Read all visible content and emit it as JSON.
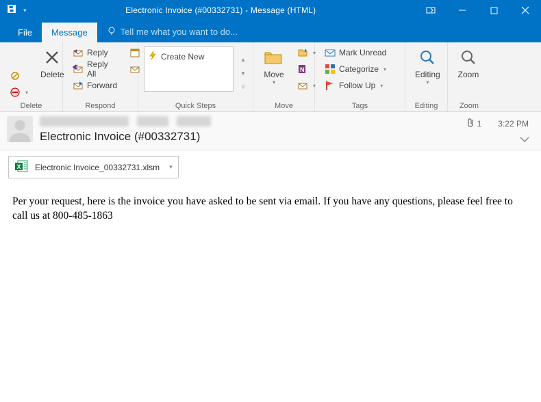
{
  "titlebar": {
    "title": "Electronic Invoice (#00332731) - Message (HTML)"
  },
  "tabs": {
    "file": "File",
    "message": "Message",
    "tell_me": "Tell me what you want to do..."
  },
  "ribbon": {
    "delete_group": {
      "label": "Delete",
      "delete": "Delete"
    },
    "respond_group": {
      "label": "Respond",
      "reply": "Reply",
      "reply_all": "Reply All",
      "forward": "Forward"
    },
    "quicksteps_group": {
      "label": "Quick Steps",
      "create_new": "Create New"
    },
    "move_group": {
      "label": "Move",
      "move": "Move"
    },
    "tags_group": {
      "label": "Tags",
      "mark_unread": "Mark Unread",
      "categorize": "Categorize",
      "follow_up": "Follow Up"
    },
    "editing_group": {
      "label": "Editing",
      "editing": "Editing"
    },
    "zoom_group": {
      "label": "Zoom",
      "zoom": "Zoom"
    }
  },
  "message": {
    "subject": "Electronic Invoice (#00332731)",
    "attachment_count": "1",
    "time": "3:22 PM",
    "attachment_name": "Electronic Invoice_00332731.xlsm",
    "body": "Per your request, here is the invoice you have asked to be sent via email. If you have any questions, please feel free to call us at 800-485-1863"
  }
}
